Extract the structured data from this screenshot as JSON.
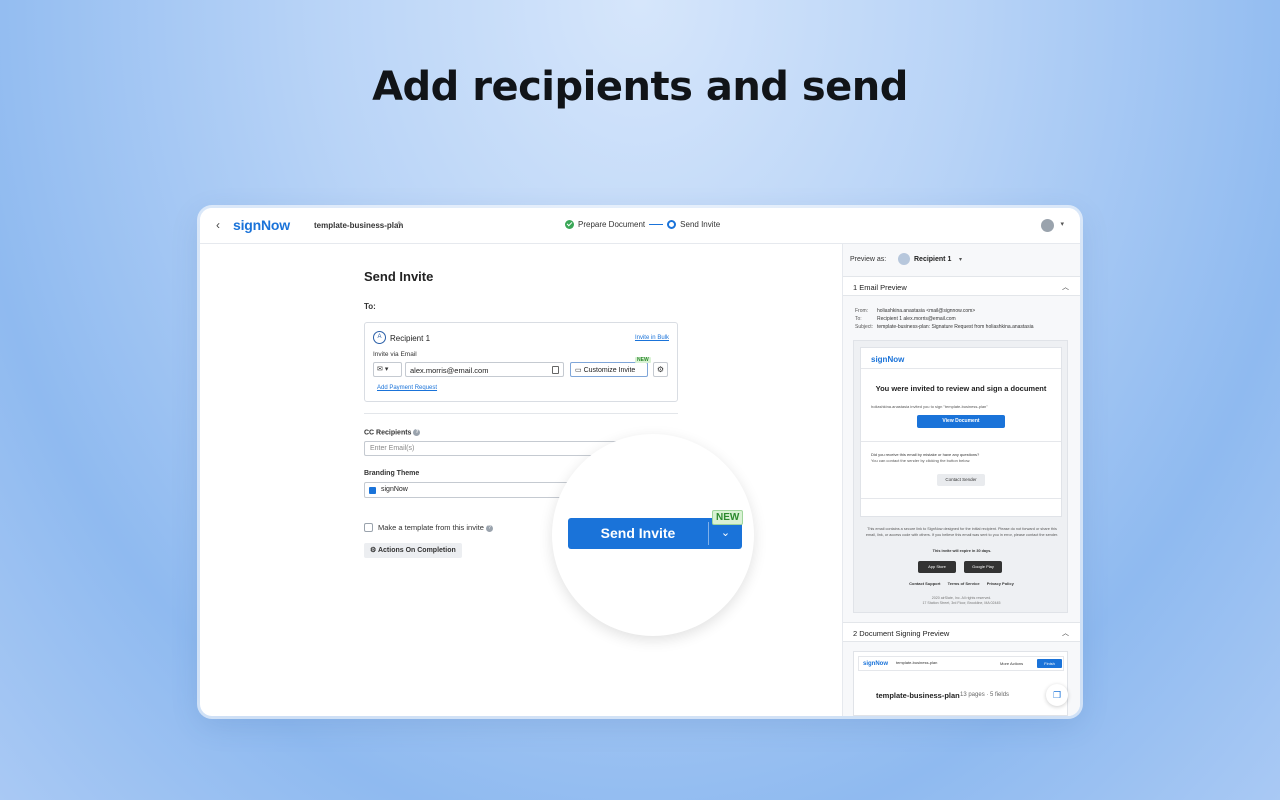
{
  "headline": "Add recipients and send",
  "topbar": {
    "back": "‹",
    "logo": "signNow",
    "doc_name": "template-business-plan",
    "step1": "Prepare Document",
    "step2": "Send Invite"
  },
  "form": {
    "title": "Send Invite",
    "to_label": "To:",
    "recipient_badge": "A",
    "recipient_name": "Recipient 1",
    "invite_bulk": "Invite in Bulk",
    "invite_via": "Invite via Email",
    "email_value": "alex.morris@email.com",
    "customize_label": "Customize Invite",
    "new_badge": "NEW",
    "payment_link": "Add Payment Request",
    "cc_label": "CC Recipients",
    "cc_placeholder": "Enter Email(s)",
    "branding_label": "Branding Theme",
    "branding_value": "signNow",
    "template_label": "Make a template from this invite",
    "actions_label": "Actions On Completion",
    "send_label": "Send Invite",
    "send_new": "NEW"
  },
  "preview": {
    "preview_as": "Preview as:",
    "recipient": "Recipient 1",
    "section1": "1  Email Preview",
    "from_label": "From:",
    "from_value": "holiashkina.anastasia <mail@signnow.com>",
    "to_label": "To:",
    "to_value": "Recipient 1  alex.morris@email.com",
    "subject_label": "Subject:",
    "subject_value": "template-business-plan: Signature Request from holiashkina.anastasia",
    "email_logo": "signNow",
    "email_title": "You were invited to review and sign a document",
    "email_sub": "holiashkina.anastasia invited you to sign \"template-business-plan\"",
    "view_btn": "View Document",
    "q1": "Did you receive this email by mistake or have any questions?",
    "q2": "You can contact the sender by clicking the button below.",
    "contact_btn": "Contact Sender",
    "foot1": "This email contains a secure link to SignNow designed for the initial recipient. Please do not forward or share this email, link, or access code with others. If you believe this email was sent to you in error, please contact the sender.",
    "foot2": "This invite will expire in 30 days.",
    "appstore": "App Store",
    "googleplay": "Google Play",
    "link1": "Contact Support",
    "link2": "Terms of Service",
    "link3": "Privacy Policy",
    "addr1": "2020 airSlate, Inc. All rights reserved.",
    "addr2": "17 Station Street, 3rd Floor, Brookline, MA 02445",
    "section2": "2  Document Signing Preview",
    "dsp_logo": "signNow",
    "dsp_doc": "template-business-plan",
    "dsp_more": "More Actions",
    "dsp_finish": "Finish",
    "dsp_name": "template-business-plan",
    "dsp_meta": "13 pages · 5 fields"
  },
  "colors": {
    "accent": "#1a73d9",
    "success": "#3aa757",
    "new_badge": "#d9f2d4"
  }
}
